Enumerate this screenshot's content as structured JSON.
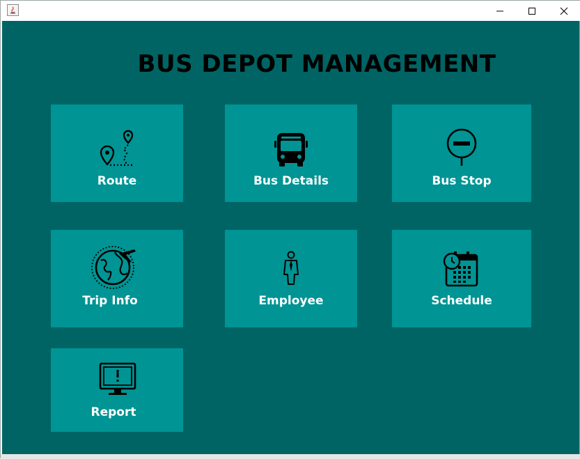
{
  "window": {
    "controls": {
      "minimize": "minimize-icon",
      "maximize": "maximize-icon",
      "close": "close-icon"
    }
  },
  "header": {
    "title": "BUS DEPOT MANAGEMENT"
  },
  "tiles": [
    {
      "label": "Route",
      "icon": "route-icon"
    },
    {
      "label": "Bus Details",
      "icon": "bus-icon"
    },
    {
      "label": "Bus Stop",
      "icon": "bus-stop-icon"
    },
    {
      "label": "Trip Info",
      "icon": "globe-plane-icon"
    },
    {
      "label": "Employee",
      "icon": "employee-icon"
    },
    {
      "label": "Schedule",
      "icon": "calendar-clock-icon"
    },
    {
      "label": "Report",
      "icon": "monitor-alert-icon"
    }
  ],
  "colors": {
    "background": "#006464",
    "tile": "#009494",
    "label": "#ffffff",
    "title": "#000000"
  }
}
